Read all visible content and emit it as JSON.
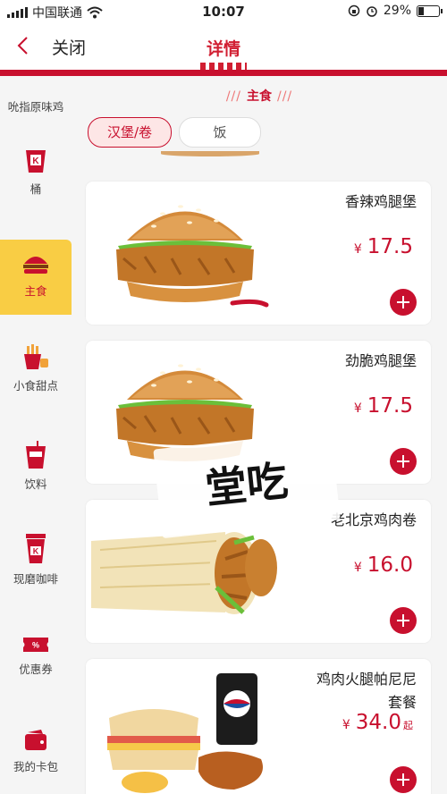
{
  "status_bar": {
    "carrier": "中国联通",
    "time": "10:07",
    "battery": "29%"
  },
  "nav": {
    "close_label": "关闭",
    "title": "详情"
  },
  "sidebar": {
    "items": [
      {
        "label": "吮指原味鸡",
        "icon": "chicken-icon"
      },
      {
        "label": "桶",
        "icon": "bucket-icon"
      },
      {
        "label": "主食",
        "icon": "burger-icon"
      },
      {
        "label": "小食甜点",
        "icon": "fries-icon"
      },
      {
        "label": "饮料",
        "icon": "drink-icon"
      },
      {
        "label": "现磨咖啡",
        "icon": "coffee-icon"
      },
      {
        "label": "优惠券",
        "icon": "coupon-icon"
      },
      {
        "label": "我的卡包",
        "icon": "wallet-icon"
      }
    ],
    "active": "主食"
  },
  "section": {
    "title": "主食",
    "deco_left": "///",
    "deco_right": "///"
  },
  "filters": {
    "chips": [
      "汉堡/卷",
      "饭"
    ],
    "active": "汉堡/卷"
  },
  "products": [
    {
      "name": "香辣鸡腿堡",
      "currency": "¥",
      "price": "17.5",
      "suffix": ""
    },
    {
      "name": "劲脆鸡腿堡",
      "currency": "¥",
      "price": "17.5",
      "suffix": ""
    },
    {
      "name": "老北京鸡肉卷",
      "currency": "¥",
      "price": "16.0",
      "suffix": ""
    },
    {
      "name_line1": "鸡肉火腿帕尼尼",
      "name_line2": "套餐",
      "currency": "¥",
      "price": "34.0",
      "suffix": "起"
    }
  ],
  "watermark": "堂吃",
  "colors": {
    "brand_red": "#c8102e",
    "active_yellow": "#f9cd44"
  }
}
